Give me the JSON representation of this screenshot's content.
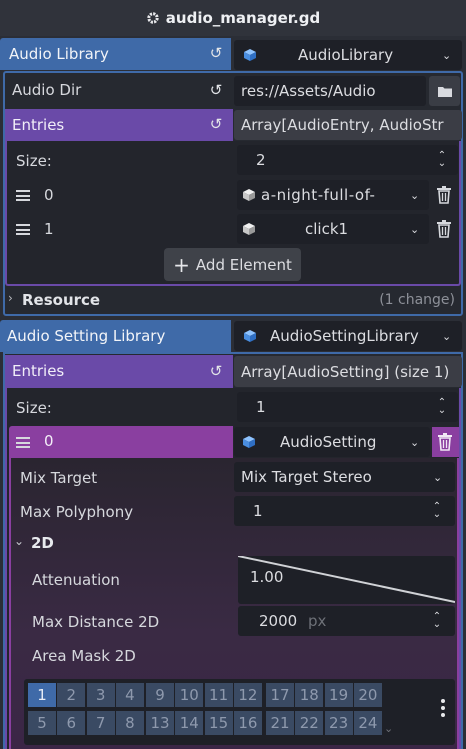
{
  "header": {
    "title": "audio_manager.gd",
    "icon": "gear-icon"
  },
  "audio_library": {
    "label": "Audio Library",
    "value": "AudioLibrary",
    "audio_dir": {
      "label": "Audio Dir",
      "value": "res://Assets/Audio"
    },
    "entries": {
      "label": "Entries",
      "value": "Array[AudioEntry, AudioStr",
      "size_label": "Size:",
      "size_value": "2",
      "items": [
        {
          "index": "0",
          "value": "a-night-full-of-"
        },
        {
          "index": "1",
          "value": "click1"
        }
      ],
      "add_element": "Add Element"
    },
    "resource": {
      "label": "Resource",
      "changes": "(1 change)"
    }
  },
  "audio_setting_library": {
    "label": "Audio Setting Library",
    "value": "AudioSettingLibrary",
    "entries": {
      "label": "Entries",
      "value": "Array[AudioSetting] (size 1)",
      "size_label": "Size:",
      "size_value": "1",
      "item": {
        "index": "0",
        "value": "AudioSetting"
      }
    },
    "mix_target": {
      "label": "Mix Target",
      "value": "Mix Target Stereo"
    },
    "max_polyphony": {
      "label": "Max Polyphony",
      "value": "1"
    },
    "section_2d": "2D",
    "attenuation": {
      "label": "Attenuation",
      "value": "1.00"
    },
    "max_distance": {
      "label": "Max Distance 2D",
      "value": "2000",
      "unit": "px"
    },
    "area_mask": {
      "label": "Area Mask 2D",
      "layers_row1": [
        "1",
        "2",
        "3",
        "4",
        "9",
        "10",
        "11",
        "12",
        "17",
        "18",
        "19",
        "20"
      ],
      "layers_row2": [
        "5",
        "6",
        "7",
        "8",
        "13",
        "14",
        "15",
        "16",
        "21",
        "22",
        "23",
        "24"
      ],
      "enabled": [
        "1"
      ]
    }
  },
  "colors": {
    "blue_header": "#3f6aa8",
    "purple_header": "#6a4aa8",
    "magenta_header": "#8a3fa0",
    "panel_bg": "#2b2e36",
    "field_bg": "#1e2027"
  }
}
